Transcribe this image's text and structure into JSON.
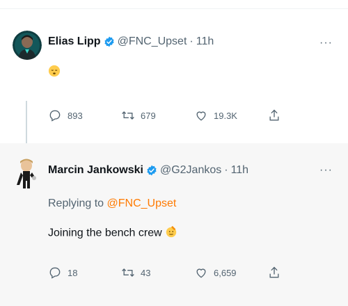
{
  "tweets": [
    {
      "display_name": "Elias Lipp",
      "verified": true,
      "handle": "@FNC_Upset",
      "separator": "·",
      "time": "11h",
      "more_label": "···",
      "content_emoji": "face-with-eyes-closed-sleeping-emoji",
      "actions": {
        "replies": "893",
        "retweets": "679",
        "likes": "19.3K"
      }
    },
    {
      "display_name": "Marcin Jankowski",
      "verified": true,
      "handle": "@G2Jankos",
      "separator": "·",
      "time": "11h",
      "more_label": "···",
      "replying_prefix": "Replying to",
      "replying_to": "@FNC_Upset",
      "text": "Joining the bench crew",
      "content_emoji": "saluting-face-emoji",
      "actions": {
        "replies": "18",
        "retweets": "43",
        "likes": "6,659"
      }
    }
  ],
  "colors": {
    "verified_badge": "#1d9bf0",
    "mention": "#ff7a00",
    "secondary_text": "#536471",
    "reply_background": "#f7f7f7"
  },
  "icons": [
    "reply-icon",
    "retweet-icon",
    "like-icon",
    "share-icon",
    "more-icon",
    "verified-badge-icon"
  ]
}
